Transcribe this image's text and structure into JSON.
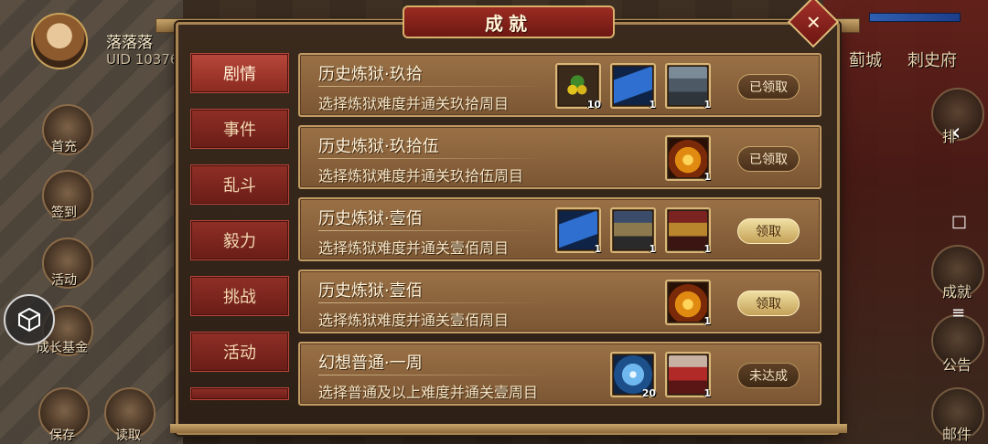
{
  "player": {
    "name": "落落落",
    "uid": "UID  10376"
  },
  "left_menu": [
    {
      "label": "首充"
    },
    {
      "label": "签到"
    },
    {
      "label": "活动"
    },
    {
      "label": "成长基金"
    },
    {
      "label": "保存"
    },
    {
      "label": "读取"
    }
  ],
  "top_right": {
    "city_label": "蓟城",
    "office_label": "刺史府"
  },
  "right_menu": [
    {
      "label": "排"
    },
    {
      "label": "成就"
    },
    {
      "label": "公告"
    },
    {
      "label": "邮件"
    }
  ],
  "system_nav": {
    "back": "‹",
    "home": "□",
    "menu": "≡"
  },
  "panel": {
    "title": "成就",
    "close_symbol": "✕"
  },
  "tabs": [
    {
      "label": "剧情",
      "active": true
    },
    {
      "label": "事件",
      "active": false
    },
    {
      "label": "乱斗",
      "active": false
    },
    {
      "label": "毅力",
      "active": false
    },
    {
      "label": "挑战",
      "active": false
    },
    {
      "label": "活动",
      "active": false
    }
  ],
  "achievements": [
    {
      "title": "历史炼狱·玖拾",
      "desc": "选择炼狱难度并通关玖拾周目",
      "rewards": [
        {
          "icon": "fruit-icon",
          "count": "10"
        },
        {
          "icon": "scroll-icon",
          "count": "1"
        },
        {
          "icon": "hero-portrait-icon",
          "count": "1"
        }
      ],
      "status": "已领取",
      "status_kind": "done"
    },
    {
      "title": "历史炼狱·玖拾伍",
      "desc": "选择炼狱难度并通关玖拾伍周目",
      "rewards": [
        {
          "icon": "treasure-chest-icon",
          "count": "1"
        }
      ],
      "status": "已领取",
      "status_kind": "done"
    },
    {
      "title": "历史炼狱·壹佰",
      "desc": "选择炼狱难度并通关壹佰周目",
      "rewards": [
        {
          "icon": "scroll-icon",
          "count": "1"
        },
        {
          "icon": "hero-portrait-icon",
          "count": "1"
        },
        {
          "icon": "hero-portrait-icon",
          "count": "1"
        }
      ],
      "status": "领取",
      "status_kind": "claim"
    },
    {
      "title": "历史炼狱·壹佰",
      "desc": "选择炼狱难度并通关壹佰周目",
      "rewards": [
        {
          "icon": "treasure-chest-icon",
          "count": "1"
        }
      ],
      "status": "领取",
      "status_kind": "claim"
    },
    {
      "title": "幻想普通·一周",
      "desc": "选择普通及以上难度并通关壹周目",
      "rewards": [
        {
          "icon": "crystal-icon",
          "count": "20"
        },
        {
          "icon": "hero-portrait-icon",
          "count": "1"
        }
      ],
      "status": "未达成",
      "status_kind": "locked"
    }
  ]
}
